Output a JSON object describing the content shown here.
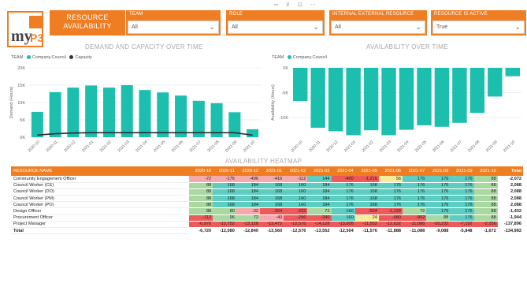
{
  "header": {
    "logo_text": "my",
    "logo_sub": "P3",
    "title_line1": "RESOURCE",
    "title_line2": "AVAILABILITY"
  },
  "filters": [
    {
      "label": "TEAM",
      "value": "All"
    },
    {
      "label": "ROLE",
      "value": "All"
    },
    {
      "label": "INTERNAL EXTERNAL RESOURCE",
      "value": "All"
    },
    {
      "label": "RESOURCE IS ACTIVE",
      "value": "True"
    }
  ],
  "demand_chart": {
    "title": "DEMAND AND CAPACITY OVER TIME",
    "legend_label": "TEAM",
    "legend": [
      {
        "name": "Company.Council",
        "color": "#1cbfae"
      },
      {
        "name": "Capacity",
        "color": "#333333"
      }
    ]
  },
  "availability_chart": {
    "title": "AVAILABILITY OVER TIME",
    "legend_label": "TEAM",
    "legend": [
      {
        "name": "Company.Council",
        "color": "#1cbfae"
      }
    ]
  },
  "chart_data": [
    {
      "type": "bar",
      "title": "DEMAND AND CAPACITY OVER TIME",
      "xlabel": "",
      "ylabel": "Demand (Hours)",
      "categories": [
        "2020-10",
        "2020-11",
        "2020-12",
        "2021-01",
        "2021-02",
        "2021-03",
        "2021-04",
        "2021-05",
        "2021-06",
        "2021-07",
        "2021-08",
        "2021-09",
        "2021-10"
      ],
      "yticks": [
        "0K",
        "5K",
        "10K",
        "15K",
        "20K"
      ],
      "ylim": [
        0,
        20000
      ],
      "series": [
        {
          "name": "Company.Council",
          "values": [
            7300,
            13000,
            14300,
            14900,
            14300,
            15000,
            13600,
            12900,
            12000,
            10500,
            9800,
            7200,
            2300
          ]
        },
        {
          "name": "Capacity",
          "values": [
            600,
            1000,
            1200,
            1300,
            1300,
            1300,
            1300,
            1300,
            1300,
            1300,
            1300,
            1300,
            600
          ]
        }
      ]
    },
    {
      "type": "bar",
      "title": "AVAILABILITY OVER TIME",
      "xlabel": "",
      "ylabel": "Availability (Hours)",
      "categories": [
        "2020-10",
        "2020-11",
        "2020-12",
        "2021-01",
        "2021-02",
        "2021-03",
        "2021-04",
        "2021-05",
        "2021-06",
        "2021-07",
        "2021-08",
        "2021-09",
        "2021-10"
      ],
      "yticks": [
        "0K",
        "-5K",
        "-10K"
      ],
      "ylim": [
        -14000,
        0
      ],
      "series": [
        {
          "name": "Company.Council",
          "values": [
            -6700,
            -12100,
            -12800,
            -13600,
            -12600,
            -13600,
            -12500,
            -11600,
            -11900,
            -11100,
            -9100,
            -5800,
            -1700
          ]
        }
      ]
    }
  ],
  "heatmap": {
    "title": "AVAILABILITY HEATMAP",
    "headers": [
      "RESOURCE NAME",
      "2020-10",
      "2020-11",
      "2020-12",
      "2021-01",
      "2021-02",
      "2021-03",
      "2021-04",
      "2021-05",
      "2021-06",
      "2021-07",
      "2021-08",
      "2021-09",
      "2021-10",
      "Total"
    ],
    "rows": [
      {
        "name": "Community Engagement Officer",
        "values": [
          "-72",
          "-176",
          "-496",
          "-416",
          "-112",
          "144",
          "-400",
          "-1,216",
          "56",
          "176",
          "176",
          "176",
          "88"
        ],
        "classes": [
          "ltred",
          "ltred",
          "ltred",
          "ltred",
          "ltred",
          "teal",
          "red",
          "red",
          "yellow",
          "teal",
          "teal",
          "teal",
          "green"
        ],
        "total": "-2,072"
      },
      {
        "name": "Council Worker (CE)",
        "values": [
          "88",
          "168",
          "184",
          "168",
          "160",
          "184",
          "176",
          "168",
          "176",
          "176",
          "176",
          "176",
          "88"
        ],
        "classes": [
          "green",
          "teal",
          "teal",
          "teal",
          "teal",
          "teal",
          "teal",
          "teal",
          "teal",
          "teal",
          "teal",
          "teal",
          "green"
        ],
        "total": "2,088"
      },
      {
        "name": "Council Worker (DO)",
        "values": [
          "88",
          "168",
          "184",
          "168",
          "160",
          "184",
          "176",
          "168",
          "176",
          "176",
          "176",
          "176",
          "88"
        ],
        "classes": [
          "green",
          "teal",
          "teal",
          "teal",
          "teal",
          "teal",
          "teal",
          "teal",
          "teal",
          "teal",
          "teal",
          "teal",
          "green"
        ],
        "total": "2,088"
      },
      {
        "name": "Council Worker (PM)",
        "values": [
          "88",
          "168",
          "184",
          "168",
          "160",
          "184",
          "176",
          "168",
          "176",
          "176",
          "176",
          "176",
          "88"
        ],
        "classes": [
          "green",
          "teal",
          "teal",
          "teal",
          "teal",
          "teal",
          "teal",
          "teal",
          "teal",
          "teal",
          "teal",
          "teal",
          "green"
        ],
        "total": "2,088"
      },
      {
        "name": "Council Worker (PO)",
        "values": [
          "88",
          "168",
          "184",
          "168",
          "160",
          "184",
          "176",
          "168",
          "176",
          "176",
          "176",
          "176",
          "88"
        ],
        "classes": [
          "green",
          "teal",
          "teal",
          "teal",
          "teal",
          "teal",
          "teal",
          "teal",
          "teal",
          "teal",
          "teal",
          "teal",
          "green"
        ],
        "total": "2,088"
      },
      {
        "name": "Design Officer",
        "values": [
          "88",
          "80",
          "-32",
          "-304",
          "-232",
          "72",
          "160",
          "-504",
          "-1,128",
          "72",
          "176",
          "176",
          "88"
        ],
        "classes": [
          "green",
          "green",
          "ltred",
          "red",
          "red",
          "green",
          "teal",
          "red",
          "red",
          "green",
          "teal",
          "teal",
          "green"
        ],
        "total": "-1,432"
      },
      {
        "name": "Procurement Officer",
        "values": [
          "-112",
          "96",
          "72",
          "-40",
          "-296",
          "-240",
          "160",
          "24",
          "-680",
          "-952",
          "88",
          "176",
          "88"
        ],
        "classes": [
          "red",
          "green",
          "green",
          "ltred",
          "red",
          "red",
          "teal",
          "yellow",
          "red",
          "red",
          "green",
          "teal",
          "green"
        ],
        "total": "-1,944"
      },
      {
        "name": "Project Manager",
        "values": [
          "-6,976",
          "-12,752",
          "-13,128",
          "-13,472",
          "-12,576",
          "-14,128",
          "-13,008",
          "-11,552",
          "-12,632",
          "-11,088",
          "-10,232",
          "-7,192",
          "-2,256"
        ],
        "classes": [
          "red",
          "red",
          "red",
          "red",
          "red",
          "red",
          "red",
          "red",
          "red",
          "red",
          "red",
          "red",
          "red"
        ],
        "total": "-137,896"
      }
    ],
    "total_row": {
      "name": "Total",
      "values": [
        "-6,720",
        "-12,080",
        "-12,840",
        "-13,560",
        "-12,576",
        "-13,552",
        "-12,504",
        "-11,576",
        "-11,888",
        "-11,088",
        "-9,088",
        "-5,848",
        "-1,672"
      ],
      "total": "-134,992"
    }
  }
}
